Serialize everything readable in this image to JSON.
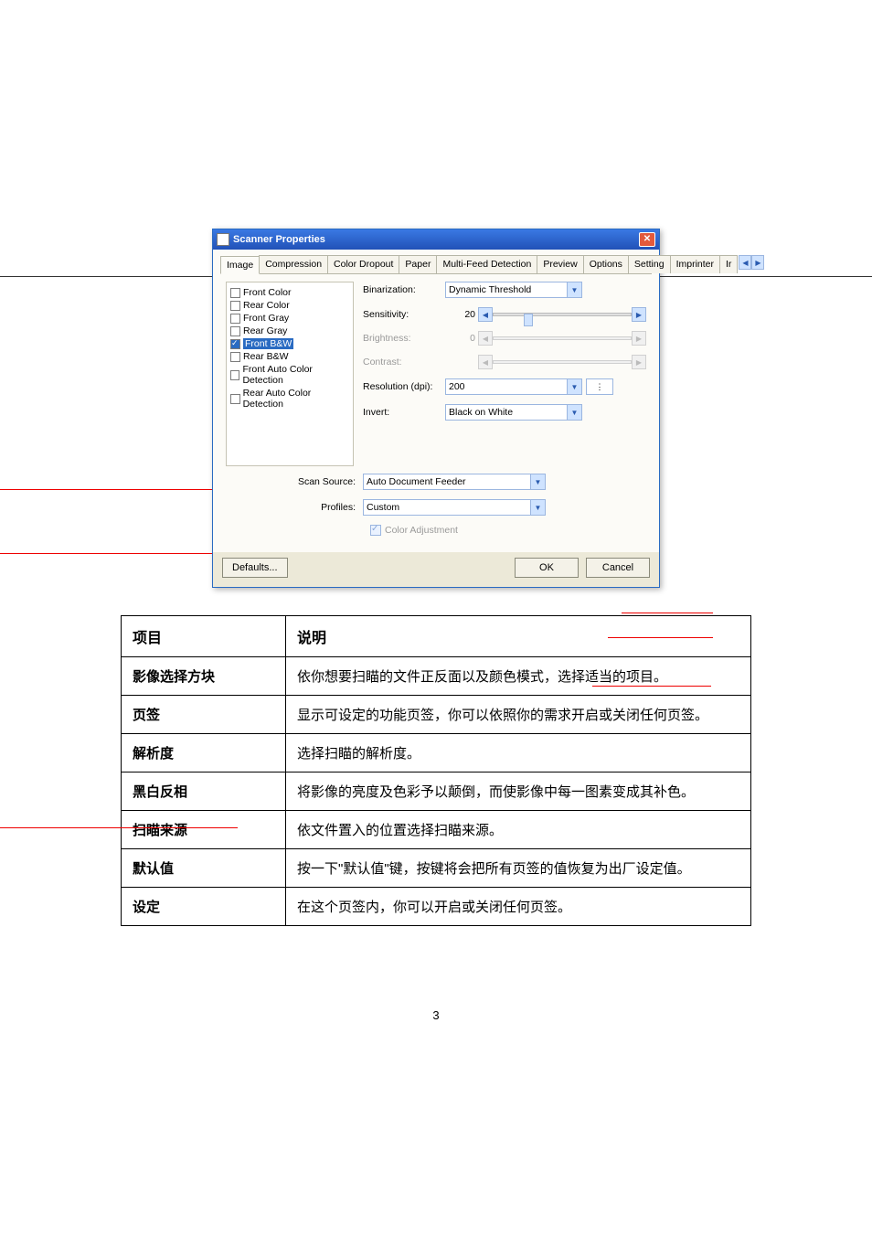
{
  "dialog": {
    "title": "Scanner Properties",
    "tabs": [
      "Image",
      "Compression",
      "Color Dropout",
      "Paper",
      "Multi-Feed Detection",
      "Preview",
      "Options",
      "Setting",
      "Imprinter",
      "Ir"
    ],
    "image_select": {
      "items": [
        {
          "label": "Front Color",
          "checked": false
        },
        {
          "label": "Rear Color",
          "checked": false
        },
        {
          "label": "Front Gray",
          "checked": false
        },
        {
          "label": "Rear Gray",
          "checked": false
        },
        {
          "label": "Front B&W",
          "checked": true,
          "selected": true
        },
        {
          "label": "Rear B&W",
          "checked": false
        },
        {
          "label": "Front Auto Color Detection",
          "checked": false
        },
        {
          "label": "Rear Auto Color Detection",
          "checked": false
        }
      ]
    },
    "settings": {
      "binarization_label": "Binarization:",
      "binarization_value": "Dynamic Threshold",
      "sensitivity_label": "Sensitivity:",
      "sensitivity_value": "20",
      "brightness_label": "Brightness:",
      "brightness_value": "0",
      "contrast_label": "Contrast:",
      "resolution_label": "Resolution (dpi):",
      "resolution_value": "200",
      "invert_label": "Invert:",
      "invert_value": "Black on White"
    },
    "lower": {
      "scan_source_label": "Scan Source:",
      "scan_source_value": "Auto Document Feeder",
      "profiles_label": "Profiles:",
      "profiles_value": "Custom",
      "color_adjustment_label": "Color Adjustment"
    },
    "buttons": {
      "defaults": "Defaults...",
      "ok": "OK",
      "cancel": "Cancel"
    }
  },
  "table": {
    "header": [
      "项目",
      "说明"
    ],
    "rows": [
      [
        "影像选择方块",
        "依你想要扫瞄的文件正反面以及颜色模式，选择适当的项目。"
      ],
      [
        "页签",
        "显示可设定的功能页签，你可以依照你的需求开启或关闭任何页签。"
      ],
      [
        "解析度",
        "选择扫瞄的解析度。"
      ],
      [
        "黑白反相",
        "将影像的亮度及色彩予以颠倒，而使影像中每一图素变成其补色。"
      ],
      [
        "扫瞄来源",
        "依文件置入的位置选择扫瞄来源。"
      ],
      [
        "默认值",
        "按一下\"默认值\"键，按键将会把所有页签的值恢复为出厂设定值。"
      ],
      [
        "设定",
        "在这个页签内，你可以开启或关闭任何页签。"
      ]
    ]
  },
  "page_number": "3"
}
